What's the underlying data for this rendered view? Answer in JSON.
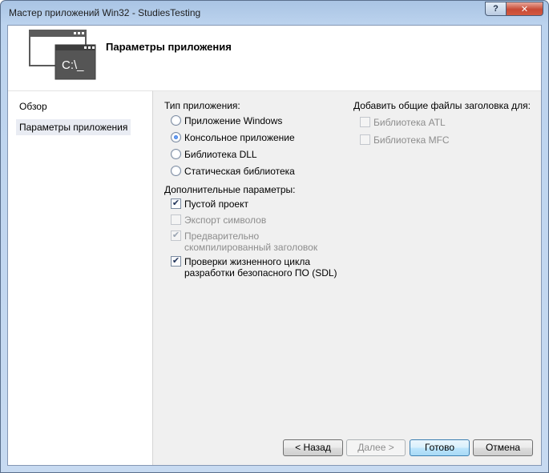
{
  "window": {
    "title": "Мастер приложений Win32 - StudiesTesting",
    "help_glyph": "?",
    "close_glyph": "✕"
  },
  "header": {
    "title": "Параметры приложения",
    "icon_text": "C:\\_"
  },
  "sidebar": {
    "items": [
      {
        "label": "Обзор",
        "selected": false
      },
      {
        "label": "Параметры приложения",
        "selected": true
      }
    ]
  },
  "app_type": {
    "label": "Тип приложения:",
    "options": [
      {
        "label": "Приложение Windows",
        "checked": false
      },
      {
        "label": "Консольное приложение",
        "checked": true
      },
      {
        "label": "Библиотека DLL",
        "checked": false
      },
      {
        "label": "Статическая библиотека",
        "checked": false
      }
    ]
  },
  "extra": {
    "label": "Дополнительные параметры:",
    "options": [
      {
        "label": "Пустой проект",
        "checked": true,
        "enabled": true
      },
      {
        "label": "Экспорт символов",
        "checked": false,
        "enabled": false
      },
      {
        "label_line1": "Предварительно",
        "label_line2": "скомпилированный заголовок",
        "checked": true,
        "enabled": false
      },
      {
        "label_line1": "Проверки жизненного цикла",
        "label_line2": "разработки безопасного ПО (SDL)",
        "checked": true,
        "enabled": true
      }
    ]
  },
  "headers": {
    "label": "Добавить общие файлы заголовка для:",
    "options": [
      {
        "label": "Библиотека ATL",
        "checked": false,
        "enabled": false
      },
      {
        "label": "Библиотека MFC",
        "checked": false,
        "enabled": false
      }
    ]
  },
  "buttons": {
    "back": "< Назад",
    "next": "Далее >",
    "finish": "Готово",
    "cancel": "Отмена"
  },
  "check_glyph": "✔"
}
